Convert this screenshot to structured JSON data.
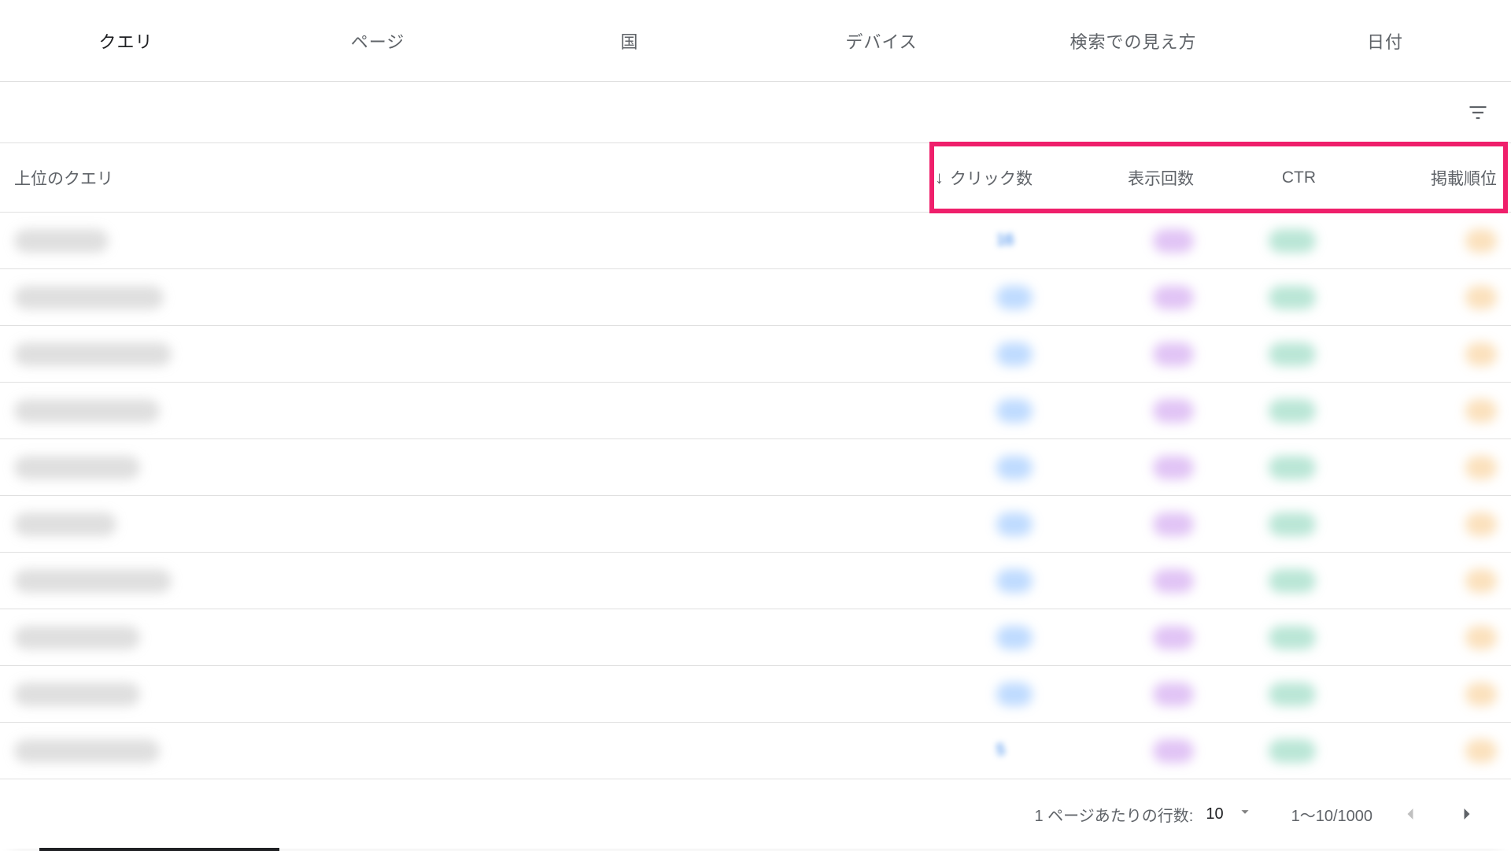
{
  "tabs": {
    "items": [
      {
        "label": "クエリ",
        "active": true
      },
      {
        "label": "ページ",
        "active": false
      },
      {
        "label": "国",
        "active": false
      },
      {
        "label": "デバイス",
        "active": false
      },
      {
        "label": "検索での見え方",
        "active": false
      },
      {
        "label": "日付",
        "active": false
      }
    ]
  },
  "columns": {
    "query_header": "上位のクエリ",
    "clicks_header": "クリック数",
    "impressions_header": "表示回数",
    "ctr_header": "CTR",
    "position_header": "掲載順位",
    "sort_indicator": "↓"
  },
  "highlight_box_color": "#ef1f6b",
  "rows": [
    {
      "query_blur_w": 120,
      "clicks_text": "16"
    },
    {
      "query_blur_w": 190
    },
    {
      "query_blur_w": 200
    },
    {
      "query_blur_w": 185
    },
    {
      "query_blur_w": 160
    },
    {
      "query_blur_w": 130
    },
    {
      "query_blur_w": 200
    },
    {
      "query_blur_w": 160
    },
    {
      "query_blur_w": 160
    },
    {
      "query_blur_w": 185,
      "clicks_text": "5"
    }
  ],
  "pagination": {
    "rows_per_page_label": "1 ページあたりの行数:",
    "rows_per_page_value": "10",
    "range_text": "1～10/1000",
    "prev_disabled": true,
    "next_disabled": false
  }
}
